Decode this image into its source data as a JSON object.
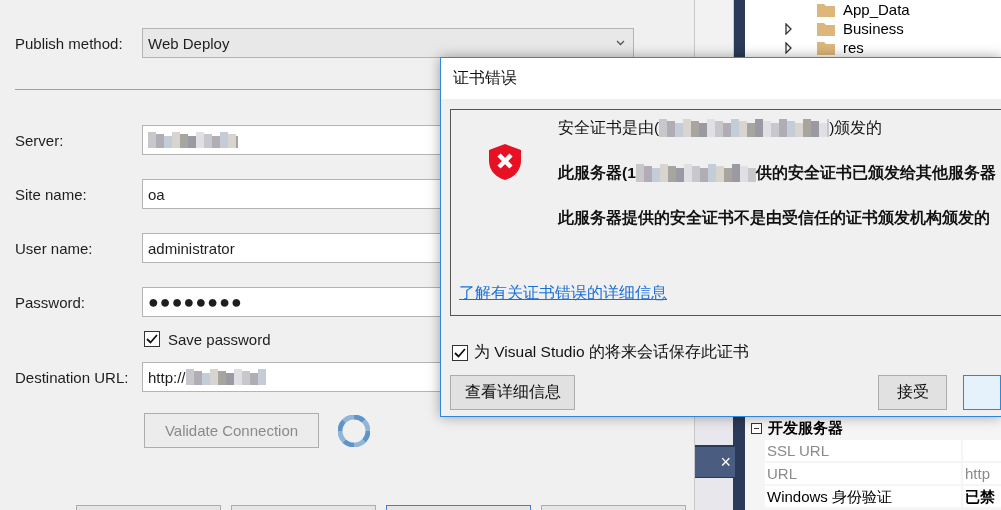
{
  "publish_method": {
    "label": "Publish method:",
    "value": "Web Deploy"
  },
  "fields": [
    {
      "label": "Server:",
      "kind": "text",
      "redacted": true
    },
    {
      "label": "Site name:",
      "kind": "text",
      "value": "oa",
      "redacted": false
    },
    {
      "label": "User name:",
      "kind": "text",
      "value": "administrator",
      "redacted": false
    },
    {
      "label": "Password:",
      "kind": "password",
      "value": "●●●●●●●●",
      "redacted": false
    }
  ],
  "save_password": {
    "label": "Save password",
    "checked": true
  },
  "destination_url": {
    "label": "Destination URL:",
    "value": "http://",
    "redacted": true
  },
  "validate_button": {
    "label": "Validate Connection",
    "disabled": true
  },
  "solution_explorer": {
    "items": [
      {
        "name": "App_Data",
        "expandable": false
      },
      {
        "name": "Business",
        "expandable": true
      },
      {
        "name": "res",
        "expandable": true
      }
    ]
  },
  "side_tab": {
    "close": "×"
  },
  "properties": {
    "category": "开发服务器",
    "rows": [
      {
        "name": "SSL URL",
        "dimmed": true
      },
      {
        "name": "URL",
        "value": "http",
        "dimmed": true
      },
      {
        "name": "Windows 身份验证",
        "value": "已禁",
        "dimmed": false
      }
    ]
  },
  "dialog": {
    "title": "证书错误",
    "messages": [
      {
        "parts": [
          "安全证书是由(",
          ")颁发的"
        ],
        "bold": false
      },
      {
        "parts": [
          "此服务器(1",
          "供的安全证书已颁发给其他服务器"
        ],
        "bold": true
      },
      {
        "parts": [
          "此服务器提供的安全证书不是由受信任的证书颁发机构颁发的"
        ],
        "bold": true
      }
    ],
    "link": "了解有关证书错误的详细信息",
    "remember": {
      "label": "为 Visual Studio 的将来会话保存此证书",
      "checked": true
    },
    "buttons": [
      {
        "label": "查看详细信息"
      },
      {
        "label": "接受"
      }
    ]
  }
}
